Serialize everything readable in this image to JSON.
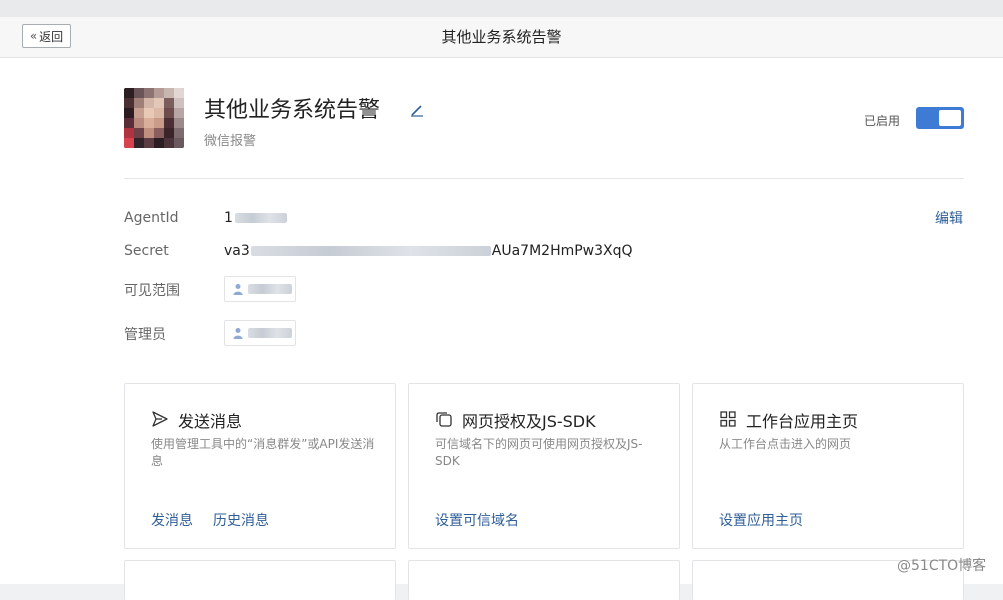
{
  "header": {
    "back_label": "返回",
    "title": "其他业务系统告警"
  },
  "app": {
    "name": "其他业务系统告警",
    "description": "微信报警",
    "status_label": "已启用",
    "enabled": true
  },
  "details": {
    "agentid_label": "AgentId",
    "agentid_value": "1",
    "secret_label": "Secret",
    "secret_prefix": "va3",
    "secret_suffix": "AUa7M2HmPw3XqQ",
    "visibility_label": "可见范围",
    "admins_label": "管理员",
    "edit_label": "编辑"
  },
  "cards": [
    {
      "icon": "send-icon",
      "title": "发送消息",
      "description": "使用管理工具中的“消息群发”或API发送消息",
      "links": [
        "发消息",
        "历史消息"
      ]
    },
    {
      "icon": "copy-icon",
      "title": "网页授权及JS-SDK",
      "description": "可信域名下的网页可使用网页授权及JS-SDK",
      "links": [
        "设置可信域名"
      ]
    },
    {
      "icon": "grid-icon",
      "title": "工作台应用主页",
      "description": "从工作台点击进入的网页",
      "links": [
        "设置应用主页"
      ]
    }
  ],
  "watermark": "@51CTO博客",
  "colors": {
    "accent": "#3e7bd4",
    "link": "#2f5f98"
  }
}
